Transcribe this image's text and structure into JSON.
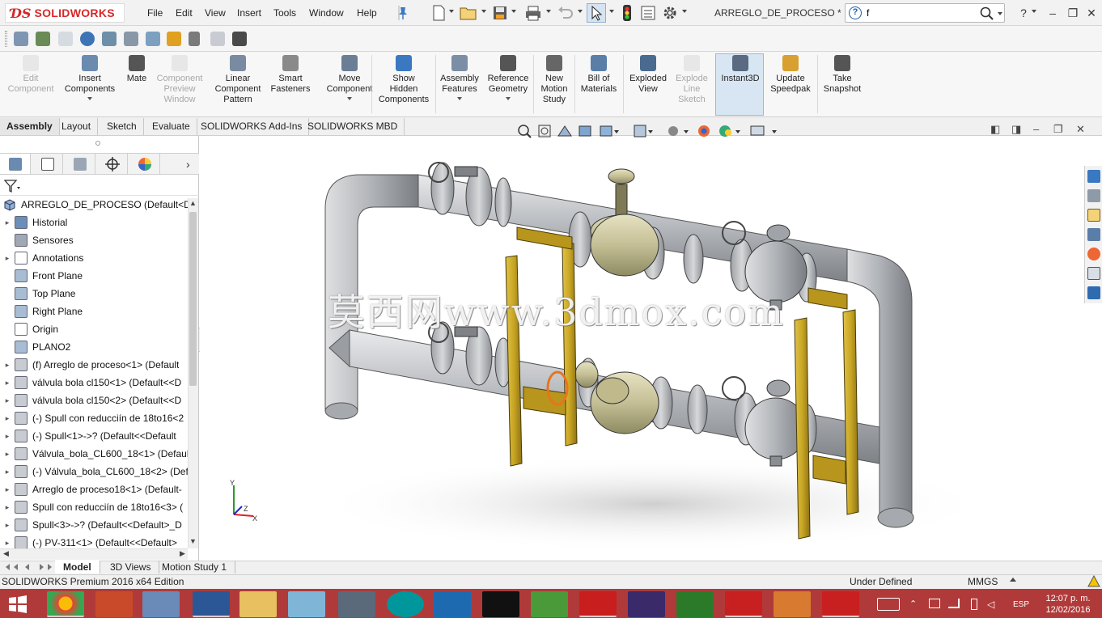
{
  "app": {
    "brand": "SOLIDWORKS",
    "document_title": "ARREGLO_DE_PROCESO *"
  },
  "menu": [
    "File",
    "Edit",
    "View",
    "Insert",
    "Tools",
    "Window",
    "Help"
  ],
  "search": {
    "value": "f"
  },
  "commands": [
    {
      "label": "Edit\nComponent",
      "icon": "edit-component-icon",
      "disabled": true
    },
    {
      "label": "Insert\nComponents",
      "icon": "insert-components-icon",
      "disabled": false,
      "dropdown": true
    },
    {
      "label": "Mate",
      "icon": "mate-icon",
      "disabled": false
    },
    {
      "label": "Component\nPreview\nWindow",
      "icon": "component-preview-icon",
      "disabled": true
    },
    {
      "label": "Linear\nComponent\nPattern",
      "icon": "linear-pattern-icon",
      "disabled": false
    },
    {
      "label": "Smart\nFasteners",
      "icon": "smart-fasteners-icon",
      "disabled": false
    },
    {
      "label": "Move\nComponent",
      "icon": "move-component-icon",
      "disabled": false,
      "dropdown": true
    },
    {
      "label": "Show\nHidden\nComponents",
      "icon": "show-hidden-icon",
      "disabled": false
    },
    {
      "label": "Assembly\nFeatures",
      "icon": "assembly-features-icon",
      "disabled": false,
      "dropdown": true
    },
    {
      "label": "Reference\nGeometry",
      "icon": "reference-geometry-icon",
      "disabled": false,
      "dropdown": true
    },
    {
      "label": "New\nMotion\nStudy",
      "icon": "motion-study-icon",
      "disabled": false
    },
    {
      "label": "Bill of\nMaterials",
      "icon": "bom-icon",
      "disabled": false
    },
    {
      "label": "Exploded\nView",
      "icon": "exploded-view-icon",
      "disabled": false
    },
    {
      "label": "Explode\nLine\nSketch",
      "icon": "explode-line-icon",
      "disabled": true
    },
    {
      "label": "Instant3D",
      "icon": "instant3d-icon",
      "disabled": false,
      "active": true
    },
    {
      "label": "Update\nSpeedpak",
      "icon": "speedpak-icon",
      "disabled": false
    },
    {
      "label": "Take\nSnapshot",
      "icon": "snapshot-icon",
      "disabled": false
    }
  ],
  "tabs": [
    "Assembly",
    "Layout",
    "Sketch",
    "Evaluate",
    "SOLIDWORKS Add-Ins",
    "SOLIDWORKS MBD"
  ],
  "tree": {
    "root": "ARREGLO_DE_PROCESO  (Default<Disp",
    "items": [
      {
        "label": "Historial",
        "expandable": true,
        "icon": "history-icon"
      },
      {
        "label": "Sensores",
        "expandable": false,
        "icon": "sensor-icon"
      },
      {
        "label": "Annotations",
        "expandable": true,
        "icon": "annotations-icon"
      },
      {
        "label": "Front Plane",
        "expandable": false,
        "icon": "plane-icon"
      },
      {
        "label": "Top Plane",
        "expandable": false,
        "icon": "plane-icon"
      },
      {
        "label": "Right Plane",
        "expandable": false,
        "icon": "plane-icon"
      },
      {
        "label": "Origin",
        "expandable": false,
        "icon": "origin-icon"
      },
      {
        "label": "PLANO2",
        "expandable": false,
        "icon": "plane-icon"
      },
      {
        "label": "(f) Arreglo de proceso<1> (Default",
        "expandable": true,
        "icon": "subassembly-icon"
      },
      {
        "label": "válvula bola cl150<1> (Default<<D",
        "expandable": true,
        "icon": "subassembly-icon"
      },
      {
        "label": "válvula bola cl150<2> (Default<<D",
        "expandable": true,
        "icon": "subassembly-icon"
      },
      {
        "label": "(-) Spull con reducciín de 18to16<2",
        "expandable": true,
        "icon": "subassembly-icon"
      },
      {
        "label": "(-) Spull<1>->? (Default<<Default",
        "expandable": true,
        "icon": "subassembly-icon"
      },
      {
        "label": "Válvula_bola_CL600_18<1> (Defaul",
        "expandable": true,
        "icon": "subassembly-icon"
      },
      {
        "label": "(-) Válvula_bola_CL600_18<2> (Def",
        "expandable": true,
        "icon": "subassembly-icon"
      },
      {
        "label": "Arreglo de proceso18<1> (Default-",
        "expandable": true,
        "icon": "subassembly-icon"
      },
      {
        "label": "Spull con reducciín de 18to16<3> (",
        "expandable": true,
        "icon": "subassembly-icon"
      },
      {
        "label": "Spull<3>->? (Default<<Default>_D",
        "expandable": true,
        "icon": "subassembly-icon"
      },
      {
        "label": "(-) PV-311<1> (Default<<Default>",
        "expandable": true,
        "icon": "subassembly-icon"
      }
    ]
  },
  "watermark": "莫西网www.3dmox.com",
  "bottom_tabs": [
    "Model",
    "3D Views",
    "Motion Study 1"
  ],
  "status": {
    "edition": "SOLIDWORKS Premium 2016 x64 Edition",
    "state": "Under Defined",
    "units": "MMGS"
  },
  "taskbar": {
    "lang": "ESP",
    "time": "12:07 p. m.",
    "date": "12/02/2016"
  },
  "colors": {
    "pipe": "#b9bcc0",
    "support": "#c9a623",
    "valve": "#c8c4a0",
    "accent_red": "#d62828",
    "taskbar": "#b03a3a",
    "selection": "#e8741e"
  }
}
